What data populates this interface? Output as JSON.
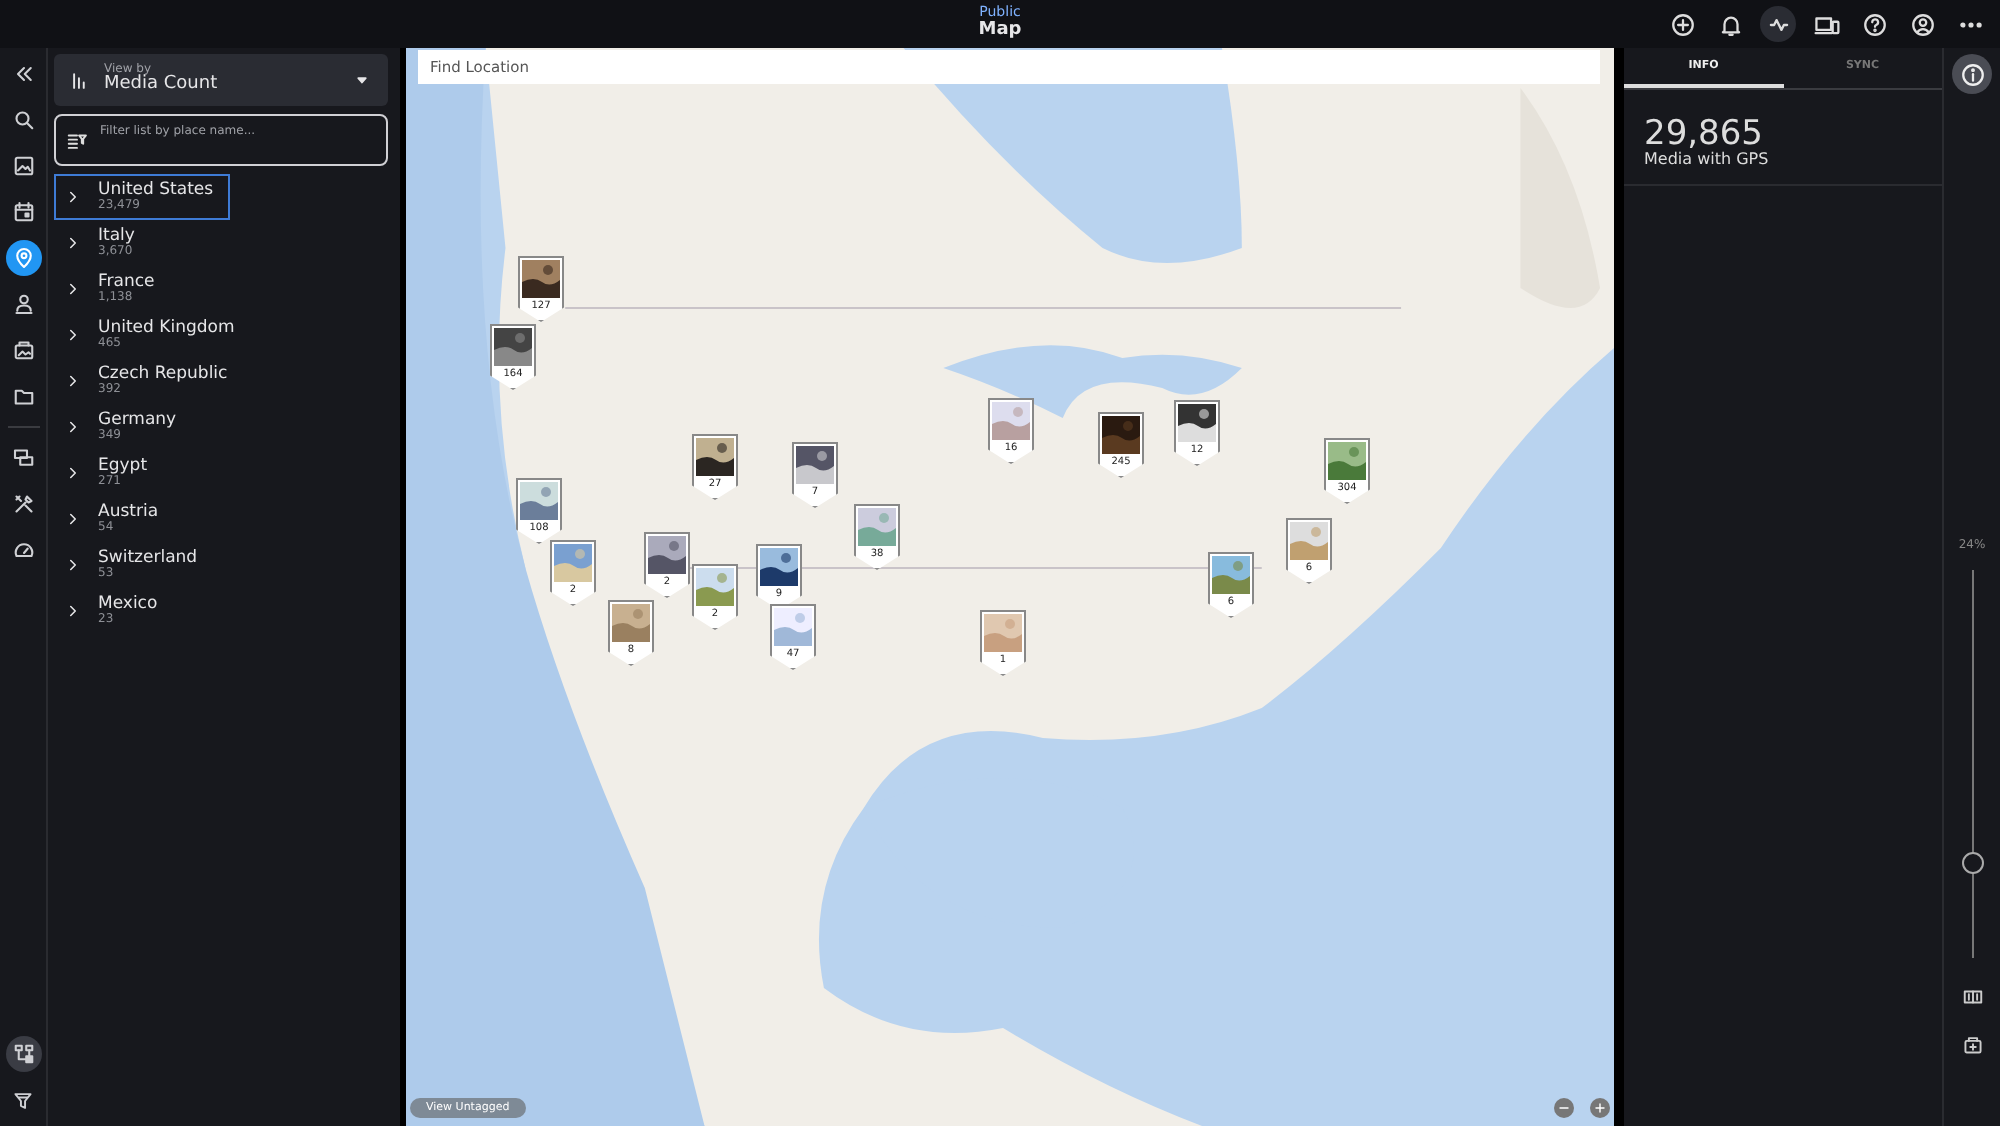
{
  "header": {
    "subtitle": "Public",
    "title": "Map"
  },
  "rail": [
    {
      "selected": false
    },
    {
      "selected": false
    },
    {
      "selected": false
    },
    {
      "selected": true
    },
    {
      "selected": false
    },
    {
      "selected": false
    },
    {
      "selected": false
    },
    {
      "selected": false
    },
    {
      "selected": false
    },
    {
      "selected": false
    }
  ],
  "view_by": {
    "label": "View by",
    "value": "Media Count"
  },
  "filter": {
    "placeholder": "Filter list by place name..."
  },
  "places": [
    {
      "name": "United States",
      "count": "23,479",
      "selected": true
    },
    {
      "name": "Italy",
      "count": "3,670",
      "selected": false
    },
    {
      "name": "France",
      "count": "1,138",
      "selected": false
    },
    {
      "name": "United Kingdom",
      "count": "465",
      "selected": false
    },
    {
      "name": "Czech Republic",
      "count": "392",
      "selected": false
    },
    {
      "name": "Germany",
      "count": "349",
      "selected": false
    },
    {
      "name": "Egypt",
      "count": "271",
      "selected": false
    },
    {
      "name": "Austria",
      "count": "54",
      "selected": false
    },
    {
      "name": "Switzerland",
      "count": "53",
      "selected": false
    },
    {
      "name": "Mexico",
      "count": "23",
      "selected": false
    }
  ],
  "map": {
    "search_placeholder": "Find Location",
    "untagged_button": "View Untagged",
    "markers": [
      {
        "count": "164"
      },
      {
        "count": "127"
      },
      {
        "count": "27"
      },
      {
        "count": "7"
      },
      {
        "count": "108"
      },
      {
        "count": "2"
      },
      {
        "count": "2"
      },
      {
        "count": "2"
      },
      {
        "count": "9"
      },
      {
        "count": "47"
      },
      {
        "count": "8"
      },
      {
        "count": "38"
      },
      {
        "count": "16"
      },
      {
        "count": "245"
      },
      {
        "count": "12"
      },
      {
        "count": "304"
      },
      {
        "count": "1"
      },
      {
        "count": "6"
      },
      {
        "count": "6"
      }
    ]
  },
  "info": {
    "tabs": [
      {
        "label": "INFO",
        "selected": true
      },
      {
        "label": "SYNC",
        "selected": false
      }
    ],
    "total": "29,865",
    "total_label": "Media with GPS"
  },
  "zoom": {
    "reading": "24%",
    "level": 0.24
  }
}
